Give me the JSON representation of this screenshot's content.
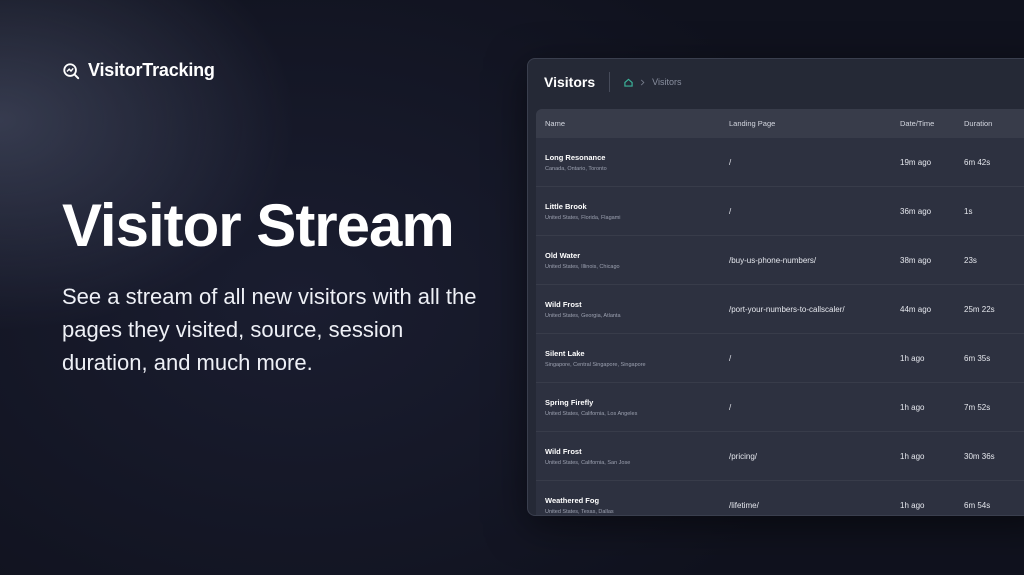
{
  "brand": {
    "name": "VisitorTracking",
    "icon": "chart-magnifier-icon"
  },
  "hero": {
    "title": "Visitor Stream",
    "description": "See a stream of all new visitors with all the pages they visited, source, session duration, and much more."
  },
  "panel": {
    "title": "Visitors",
    "breadcrumb": {
      "home_icon": "home-icon",
      "separator_icon": "chevron-right-icon",
      "current": "Visitors"
    },
    "columns": {
      "name": "Name",
      "landing": "Landing Page",
      "date": "Date/Time",
      "duration": "Duration"
    },
    "rows": [
      {
        "name": "Long Resonance",
        "location": "Canada, Ontario, Toronto",
        "landing": "/",
        "date": "19m ago",
        "duration": "6m 42s"
      },
      {
        "name": "Little Brook",
        "location": "United States, Florida, Flagami",
        "landing": "/",
        "date": "36m ago",
        "duration": "1s"
      },
      {
        "name": "Old Water",
        "location": "United States, Illinois, Chicago",
        "landing": "/buy-us-phone-numbers/",
        "date": "38m ago",
        "duration": "23s"
      },
      {
        "name": "Wild Frost",
        "location": "United States, Georgia, Atlanta",
        "landing": "/port-your-numbers-to-callscaler/",
        "date": "44m ago",
        "duration": "25m 22s"
      },
      {
        "name": "Silent Lake",
        "location": "Singapore, Central Singapore, Singapore",
        "landing": "/",
        "date": "1h ago",
        "duration": "6m 35s"
      },
      {
        "name": "Spring Firefly",
        "location": "United States, California, Los Angeles",
        "landing": "/",
        "date": "1h ago",
        "duration": "7m 52s"
      },
      {
        "name": "Wild Frost",
        "location": "United States, California, San Jose",
        "landing": "/pricing/",
        "date": "1h ago",
        "duration": "30m 36s"
      },
      {
        "name": "Weathered Fog",
        "location": "United States, Texas, Dallas",
        "landing": "/lifetime/",
        "date": "1h ago",
        "duration": "6m 54s"
      }
    ]
  },
  "colors": {
    "accent": "#3bb39a",
    "background": "#10121e",
    "panel": "#252936"
  }
}
